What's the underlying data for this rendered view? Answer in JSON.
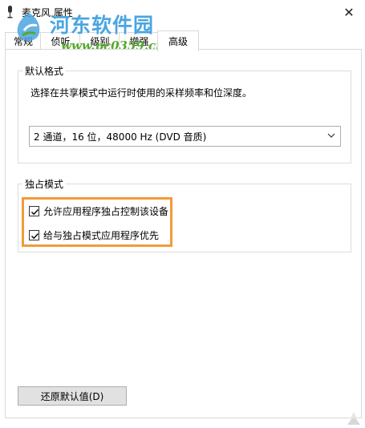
{
  "window": {
    "title": "麦克风 属性",
    "close_glyph": "✕"
  },
  "watermark": {
    "cn_text": "河东软件园",
    "url_text": "www.pc0359.cn"
  },
  "tabs": [
    {
      "label": "常规",
      "active": false
    },
    {
      "label": "侦听",
      "active": false
    },
    {
      "label": "级别",
      "active": false
    },
    {
      "label": "增强",
      "active": false
    },
    {
      "label": "高级",
      "active": true
    }
  ],
  "default_format": {
    "title": "默认格式",
    "description": "选择在共享模式中运行时使用的采样频率和位深度。",
    "selected": "2 通道，16 位，48000 Hz (DVD 音质)"
  },
  "exclusive_mode": {
    "title": "独占模式",
    "options": [
      {
        "label": "允许应用程序独占控制该设备",
        "checked": true
      },
      {
        "label": "给与独占模式应用程序优先",
        "checked": true
      }
    ]
  },
  "buttons": {
    "restore_defaults": "还原默认值(D)"
  },
  "colors": {
    "highlight": "#f39a3b",
    "watermark_blue": "#4aa5e0",
    "watermark_green": "#57a92b"
  }
}
